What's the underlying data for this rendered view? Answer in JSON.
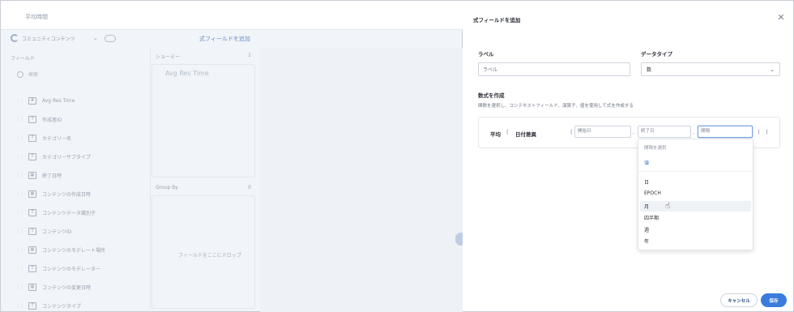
{
  "background": {
    "title": "平均時間",
    "source_name": "コミュニティコンテンツ",
    "add_formula_link": "式フィールドを追加",
    "fields_header": "フィールド",
    "search_placeholder": "検索",
    "summary_header": "ショーミー",
    "summary_count": "1",
    "measure": "Avg Res Time",
    "groupby_header": "Group By",
    "groupby_count": "0",
    "groupby_hint": "フィールドをここにドロップ",
    "fields": [
      {
        "label": "Avg Res Time",
        "type": "number-icon"
      },
      {
        "label": "作成者ID",
        "type": "text-icon"
      },
      {
        "label": "カテゴリー名",
        "type": "text-icon"
      },
      {
        "label": "カテゴリーサブタイプ",
        "type": "text-icon"
      },
      {
        "label": "終了日時",
        "type": "date-icon"
      },
      {
        "label": "コンテンツの作成日時",
        "type": "date-icon"
      },
      {
        "label": "コンテンツデータ識別子",
        "type": "text-icon"
      },
      {
        "label": "コンテンツID",
        "type": "text-icon"
      },
      {
        "label": "コンテンツのモデレート場所",
        "type": "date-icon"
      },
      {
        "label": "コンテンツのモデレーター",
        "type": "text-icon"
      },
      {
        "label": "コンテンツの変更日時",
        "type": "date-icon"
      },
      {
        "label": "コンテンツタイプ",
        "type": "text-icon"
      }
    ]
  },
  "panel": {
    "title": "式フィールドを追加",
    "label_field": {
      "label": "ラベル",
      "value": "ラベル"
    },
    "datatype_field": {
      "label": "データタイプ",
      "value": "数"
    },
    "formula_heading": "数式を作成",
    "formula_description": "関数を選択し、コンテキストフィールド、演算子、値を使用して式を作成する",
    "formula": {
      "function": "平均",
      "inner_function": "日付差異",
      "args": [
        "開始日",
        "終了日",
        "間隔"
      ]
    },
    "dropdown": {
      "placeholder": "間隔を選択",
      "value_option": "値",
      "options": [
        "日",
        "EPOCH",
        "月",
        "四半期",
        "週",
        "年"
      ],
      "hovered": "月"
    },
    "cancel_label": "キャンセル",
    "save_label": "保存"
  }
}
